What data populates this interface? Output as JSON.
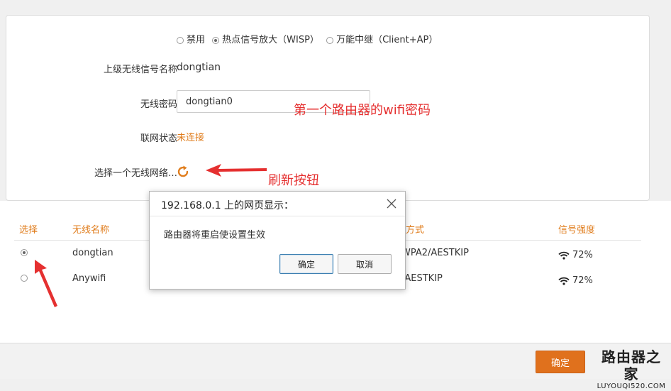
{
  "mode": {
    "options": [
      {
        "label": "禁用",
        "selected": false
      },
      {
        "label": "热点信号放大（WISP）",
        "selected": true
      },
      {
        "label": "万能中继（Client+AP）",
        "selected": false
      }
    ]
  },
  "upstream": {
    "label": "上级无线信号名称",
    "value": "dongtian"
  },
  "password": {
    "label": "无线密码",
    "value": "dongtian0"
  },
  "link": {
    "label": "联网状态",
    "value": "未连接"
  },
  "choose": {
    "label": "选择一个无线网络…"
  },
  "annotations": {
    "password_note": "第一个路由器的wifi密码",
    "refresh_note": "刷新按钮"
  },
  "table": {
    "headers": {
      "select": "选择",
      "name": "无线名称",
      "security_partial": "方式",
      "signal": "信号强度"
    },
    "rows": [
      {
        "selected": true,
        "name": "dongtian",
        "security_partial": "WPA2/AESTKIP",
        "signal": "72%"
      },
      {
        "selected": false,
        "name": "Anywifi",
        "security_partial": "/AESTKIP",
        "signal": "72%"
      }
    ]
  },
  "footer": {
    "ok_label": "确定"
  },
  "logo": {
    "cn": "路由器之家",
    "en": "LUYOUQI520.COM"
  },
  "dialog": {
    "title": "192.168.0.1 上的网页显示：",
    "message": "路由器将重启使设置生效",
    "ok_label": "确定",
    "cancel_label": "取消"
  },
  "colors": {
    "accent": "#e07d1d",
    "annotation": "#e53030"
  }
}
